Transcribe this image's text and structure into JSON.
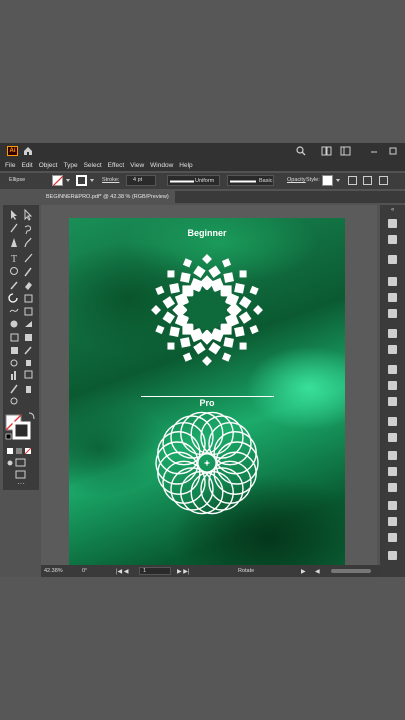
{
  "app": {
    "logo_text": "Ai",
    "menu": [
      "File",
      "Edit",
      "Object",
      "Type",
      "Select",
      "Effect",
      "View",
      "Window",
      "Help"
    ]
  },
  "control_bar": {
    "selection": "Ellipse",
    "stroke_label": "Stroke:",
    "stroke_value": "4 pt",
    "profile": "Uniform",
    "brush": "Basic",
    "opacity_label": "Opacity",
    "style_label": "Style:",
    "fill_color": "#ffffff"
  },
  "document": {
    "tab_title": "BEGINNER&PRO.pdf* @ 42.38 % (RGB/Preview)"
  },
  "artwork": {
    "title_top": "Beginner",
    "title_bottom": "Pro",
    "background_colors": [
      "#0b5a31",
      "#1cab6b",
      "#085a30"
    ]
  },
  "status_bar": {
    "zoom": "42.38%",
    "rotation": "0°",
    "artboard_number": "1",
    "active_tool": "Rotate"
  }
}
